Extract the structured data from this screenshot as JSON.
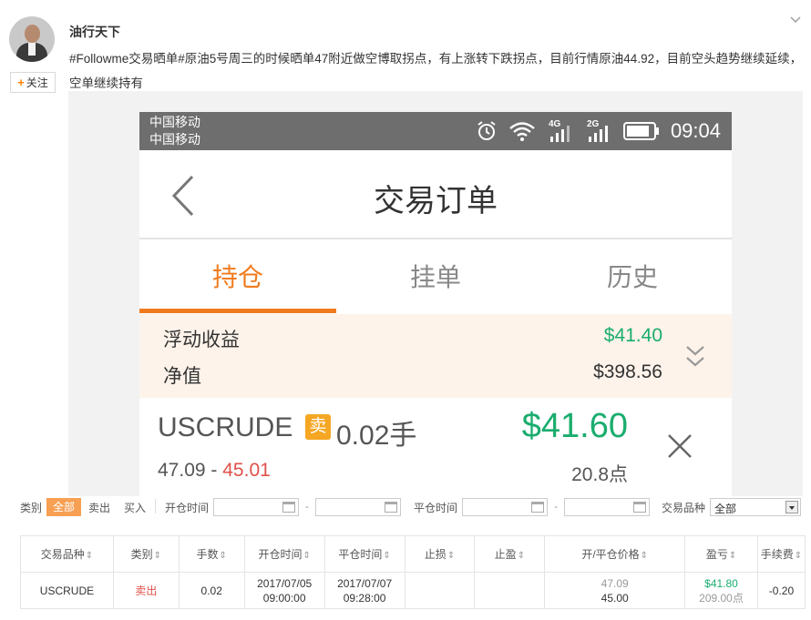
{
  "post": {
    "username": "油行天下",
    "follow_label": "关注",
    "text": "#Followme交易晒单#原油5号周三的时候晒单47附近做空博取拐点，有上涨转下跌拐点，目前行情原油44.92，目前空头趋势继续延续，空单继续持有"
  },
  "phone": {
    "status": {
      "carrier1": "中国移动",
      "carrier2": "中国移动",
      "net1": "4G",
      "net2": "2G",
      "time": "09:04"
    },
    "nav_title": "交易订单",
    "tabs": [
      {
        "label": "持仓",
        "active": true
      },
      {
        "label": "挂单",
        "active": false
      },
      {
        "label": "历史",
        "active": false
      }
    ],
    "summary": {
      "floating_label": "浮动收益",
      "floating_value": "$41.40",
      "equity_label": "净值",
      "equity_value": "$398.56"
    },
    "order": {
      "symbol": "USCRUDE",
      "side_badge": "卖",
      "lots": "0.02手",
      "open_price": "47.09",
      "range_sep": "-",
      "close_price": "45.01",
      "profit": "$41.60",
      "points": "20.8点"
    }
  },
  "filter": {
    "type_label": "类别",
    "all": "全部",
    "sell": "卖出",
    "buy": "买入",
    "open_time_label": "开仓时间",
    "close_time_label": "平仓时间",
    "dash": "-",
    "symbol_label": "交易品种",
    "symbol_value": "全部"
  },
  "table": {
    "headers": [
      "交易品种",
      "类别",
      "手数",
      "开仓时间",
      "平仓时间",
      "止损",
      "止盈",
      "开/平仓价格",
      "盈亏",
      "手续费"
    ],
    "row": {
      "symbol": "USCRUDE",
      "type": "卖出",
      "lots": "0.02",
      "open_date": "2017/07/05",
      "open_time": "09:00:00",
      "close_date": "2017/07/07",
      "close_time": "09:28:00",
      "stop_loss": "",
      "take_profit": "",
      "open_price": "47.09",
      "close_price": "45.00",
      "pnl": "$41.80",
      "pnl_points": "209.00点",
      "fee": "-0.20"
    }
  },
  "colors": {
    "accent_orange": "#f07b1e",
    "profit_green": "#1aad6e",
    "loss_red": "#e0504a"
  }
}
